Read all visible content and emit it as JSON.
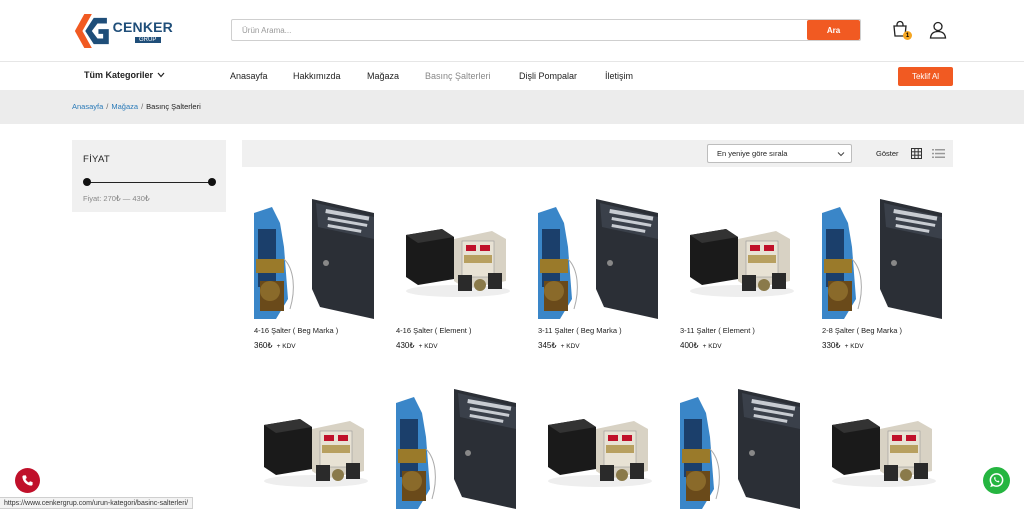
{
  "brand": {
    "name": "CENKER",
    "sub": "GRUP"
  },
  "search": {
    "placeholder": "Ürün Arama...",
    "button": "Ara"
  },
  "cart": {
    "count": "1"
  },
  "nav": {
    "categories": "Tüm Kategoriler",
    "items": [
      "Anasayfa",
      "Hakkımızda",
      "Mağaza",
      "Basınç Şalterleri",
      "Dişli Pompalar",
      "İletişim"
    ],
    "active": "Basınç Şalterleri",
    "offer_button": "Teklif Al"
  },
  "breadcrumb": {
    "home": "Anasayfa",
    "shop": "Mağaza",
    "current": "Basınç Şalterleri",
    "separator": "/"
  },
  "filter": {
    "title": "FİYAT",
    "range_text": "Fiyat: 270₺ — 430₺"
  },
  "toolbar": {
    "sort_selected": "En yeniye göre sırala",
    "show_label": "Göster"
  },
  "products": [
    {
      "name": "4-16 Şalter ( Beg Marka )",
      "price": "360₺",
      "tax": "+ KDV",
      "image": "beg"
    },
    {
      "name": "4-16 Şalter ( Element )",
      "price": "430₺",
      "tax": "+ KDV",
      "image": "element"
    },
    {
      "name": "3-11 Şalter ( Beg Marka )",
      "price": "345₺",
      "tax": "+ KDV",
      "image": "beg"
    },
    {
      "name": "3-11 Şalter ( Element )",
      "price": "400₺",
      "tax": "+ KDV",
      "image": "element"
    },
    {
      "name": "2-8 Şalter ( Beg Marka )",
      "price": "330₺",
      "tax": "+ KDV",
      "image": "beg"
    },
    {
      "image": "element"
    },
    {
      "image": "beg"
    },
    {
      "image": "element"
    },
    {
      "image": "beg"
    },
    {
      "image": "element"
    }
  ],
  "status_url": "https://www.cenkergrup.com/urun-kategori/basinc-salterleri/",
  "colors": {
    "accent": "#f15a22",
    "link": "#2a7ab8",
    "brand": "#1f4e79",
    "call": "#c0102a",
    "whatsapp": "#25b540"
  }
}
